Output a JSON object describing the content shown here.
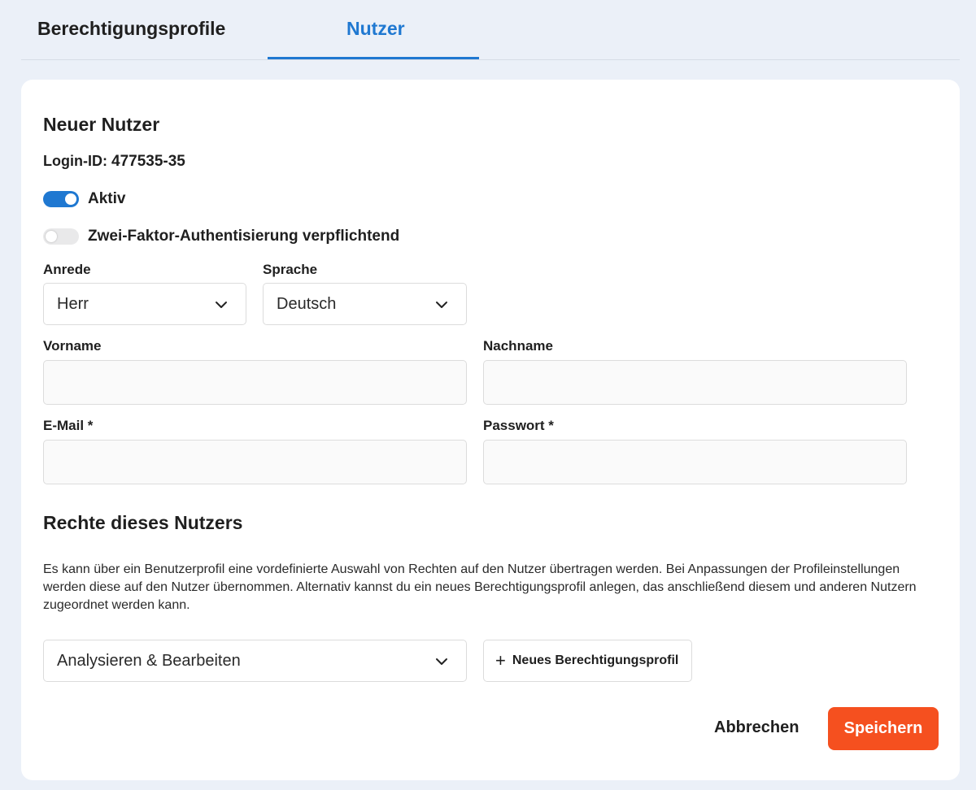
{
  "tabs": [
    {
      "label": "Berechtigungsprofile",
      "active": false
    },
    {
      "label": "Nutzer",
      "active": true
    }
  ],
  "form": {
    "title": "Neuer Nutzer",
    "login_label": "Login-ID:",
    "login_value": "477535-35",
    "toggles": {
      "active": {
        "label": "Aktiv",
        "on": true
      },
      "two_factor": {
        "label": "Zwei-Faktor-Authentisierung verpflichtend",
        "on": false
      }
    },
    "salutation": {
      "label": "Anrede",
      "value": "Herr"
    },
    "language": {
      "label": "Sprache",
      "value": "Deutsch"
    },
    "first_name": {
      "label": "Vorname",
      "value": ""
    },
    "last_name": {
      "label": "Nachname",
      "value": ""
    },
    "email": {
      "label": "E-Mail *",
      "value": ""
    },
    "password": {
      "label": "Passwort *",
      "value": ""
    }
  },
  "rights": {
    "title": "Rechte dieses Nutzers",
    "description": "Es kann über ein Benutzerprofil eine vordefinierte Auswahl von Rechten auf den Nutzer übertragen werden. Bei Anpassungen der Profileinstellungen werden diese auf den Nutzer übernommen. Alternativ kannst du ein neues Berechtigungsprofil anlegen, das anschließend diesem und anderen Nutzern zugeordnet werden kann.",
    "profile_value": "Analysieren & Bearbeiten",
    "new_profile_label": "Neues Berechtigungsprofil"
  },
  "actions": {
    "cancel_label": "Abbrechen",
    "save_label": "Speichern"
  },
  "colors": {
    "accent": "#1f78d1",
    "save": "#f5501f",
    "background": "#ebf0f8"
  },
  "icons": {
    "dropdown": "chevron-down-icon",
    "add": "plus-icon"
  }
}
